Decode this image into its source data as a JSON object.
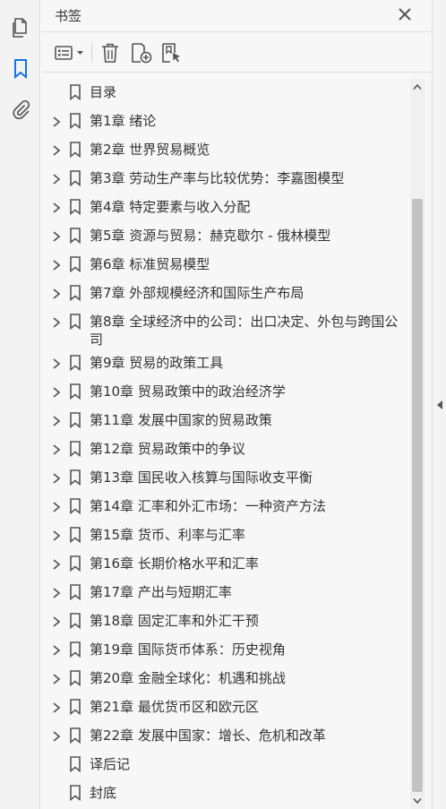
{
  "left_rail": {
    "icons": [
      "pages-icon",
      "bookmark-icon",
      "attachment-icon"
    ],
    "active_index": 1
  },
  "panel": {
    "title": "书签",
    "close_icon": "close-icon"
  },
  "toolbar": {
    "icons": [
      "options-menu-icon",
      "delete-icon",
      "new-bookmark-icon",
      "new-bookmark-from-structure-icon"
    ]
  },
  "bookmarks": [
    {
      "label": "目录",
      "expandable": false
    },
    {
      "label": "第1章  绪论",
      "expandable": true
    },
    {
      "label": "第2章  世界贸易概览",
      "expandable": true
    },
    {
      "label": "第3章  劳动生产率与比较优势：李嘉图模型",
      "expandable": true
    },
    {
      "label": "第4章  特定要素与收入分配",
      "expandable": true
    },
    {
      "label": "第5章  资源与贸易：赫克歇尔 - 俄林模型",
      "expandable": true
    },
    {
      "label": "第6章  标准贸易模型",
      "expandable": true
    },
    {
      "label": "第7章  外部规模经济和国际生产布局",
      "expandable": true
    },
    {
      "label": "第8章  全球经济中的公司：出口决定、外包与跨国公司",
      "expandable": true
    },
    {
      "label": "第9章  贸易的政策工具",
      "expandable": true
    },
    {
      "label": "第10章  贸易政策中的政治经济学",
      "expandable": true
    },
    {
      "label": "第11章  发展中国家的贸易政策",
      "expandable": true
    },
    {
      "label": "第12章  贸易政策中的争议",
      "expandable": true
    },
    {
      "label": "第13章  国民收入核算与国际收支平衡",
      "expandable": true
    },
    {
      "label": "第14章  汇率和外汇市场：一种资产方法",
      "expandable": true
    },
    {
      "label": "第15章  货币、利率与汇率",
      "expandable": true
    },
    {
      "label": "第16章  长期价格水平和汇率",
      "expandable": true
    },
    {
      "label": "第17章  产出与短期汇率",
      "expandable": true
    },
    {
      "label": "第18章  固定汇率和外汇干预",
      "expandable": true
    },
    {
      "label": "第19章  国际货币体系：历史视角",
      "expandable": true
    },
    {
      "label": "第20章  金融全球化：机遇和挑战",
      "expandable": true
    },
    {
      "label": "第21章  最优货币区和欧元区",
      "expandable": true
    },
    {
      "label": "第22章  发展中国家：增长、危机和改革",
      "expandable": true
    },
    {
      "label": "译后记",
      "expandable": false
    },
    {
      "label": "封底",
      "expandable": false
    }
  ],
  "colors": {
    "accent": "#1473e6",
    "icon": "#555555",
    "text": "#333333"
  }
}
